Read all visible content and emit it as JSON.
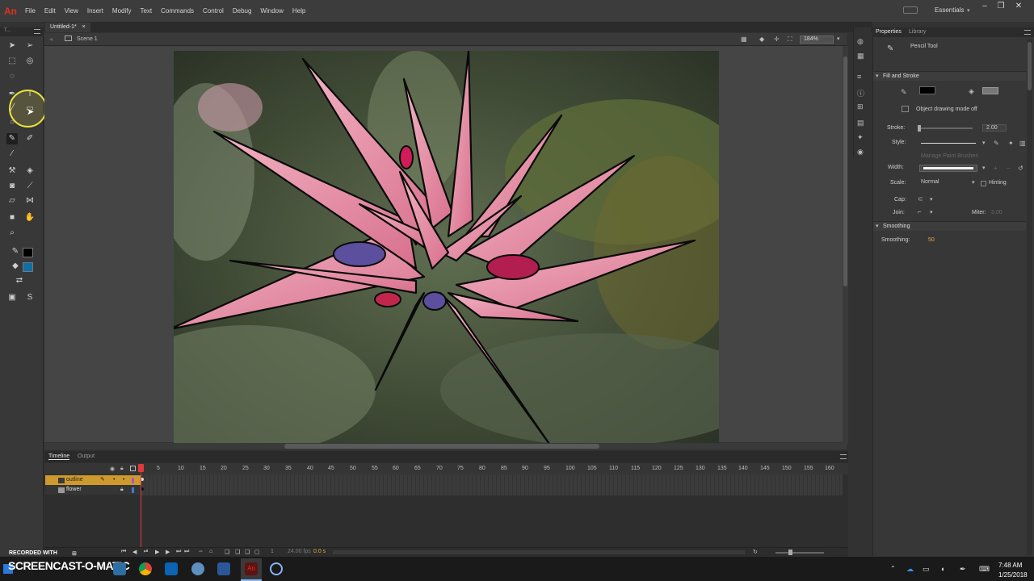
{
  "app": {
    "logo": "An",
    "workspace": "Essentials"
  },
  "menu": [
    "File",
    "Edit",
    "View",
    "Insert",
    "Modify",
    "Text",
    "Commands",
    "Control",
    "Debug",
    "Window",
    "Help"
  ],
  "document": {
    "tab": "Untitled-1*",
    "scene": "Scene 1",
    "zoom": "184%"
  },
  "tools_panel": {
    "title": "T..."
  },
  "timeline": {
    "tabs": [
      "Timeline",
      "Output"
    ],
    "frame_numbers": [
      "1",
      "5",
      "10",
      "15",
      "20",
      "25",
      "30",
      "35",
      "40",
      "45",
      "50",
      "55",
      "60",
      "65",
      "70",
      "75",
      "80",
      "85",
      "90",
      "95",
      "100",
      "105",
      "110",
      "115",
      "120",
      "125",
      "130",
      "135",
      "140",
      "145",
      "150",
      "155",
      "160"
    ],
    "layers": [
      "outline",
      "flower"
    ],
    "current_frame": "1",
    "fps": "24.00 fps",
    "time": "0.0 s"
  },
  "properties": {
    "tabs": [
      "Properties",
      "Library"
    ],
    "tool_name": "Pencil Tool",
    "sections": {
      "fill_stroke": "Fill and Stroke",
      "smoothing": "Smoothing"
    },
    "object_drawing": "Object drawing mode off",
    "stroke_label": "Stroke:",
    "stroke_value": "2.00",
    "style_label": "Style:",
    "manage_brushes": "Manage Paint Brushes",
    "width_label": "Width:",
    "scale_label": "Scale:",
    "scale_value": "Normal",
    "hinting": "Hinting",
    "cap_label": "Cap:",
    "join_label": "Join:",
    "miter_label": "Miter:",
    "miter_value": "3.00",
    "smoothing_label": "Smoothing:",
    "smoothing_value": "50",
    "stroke_color": "#000000",
    "fill_color": "#0d6fa8"
  },
  "watermark": {
    "small": "RECORDED WITH",
    "big": "SCREENCAST-O-MATIC"
  },
  "clock": {
    "time": "7:48 AM",
    "date": "1/25/2018"
  }
}
